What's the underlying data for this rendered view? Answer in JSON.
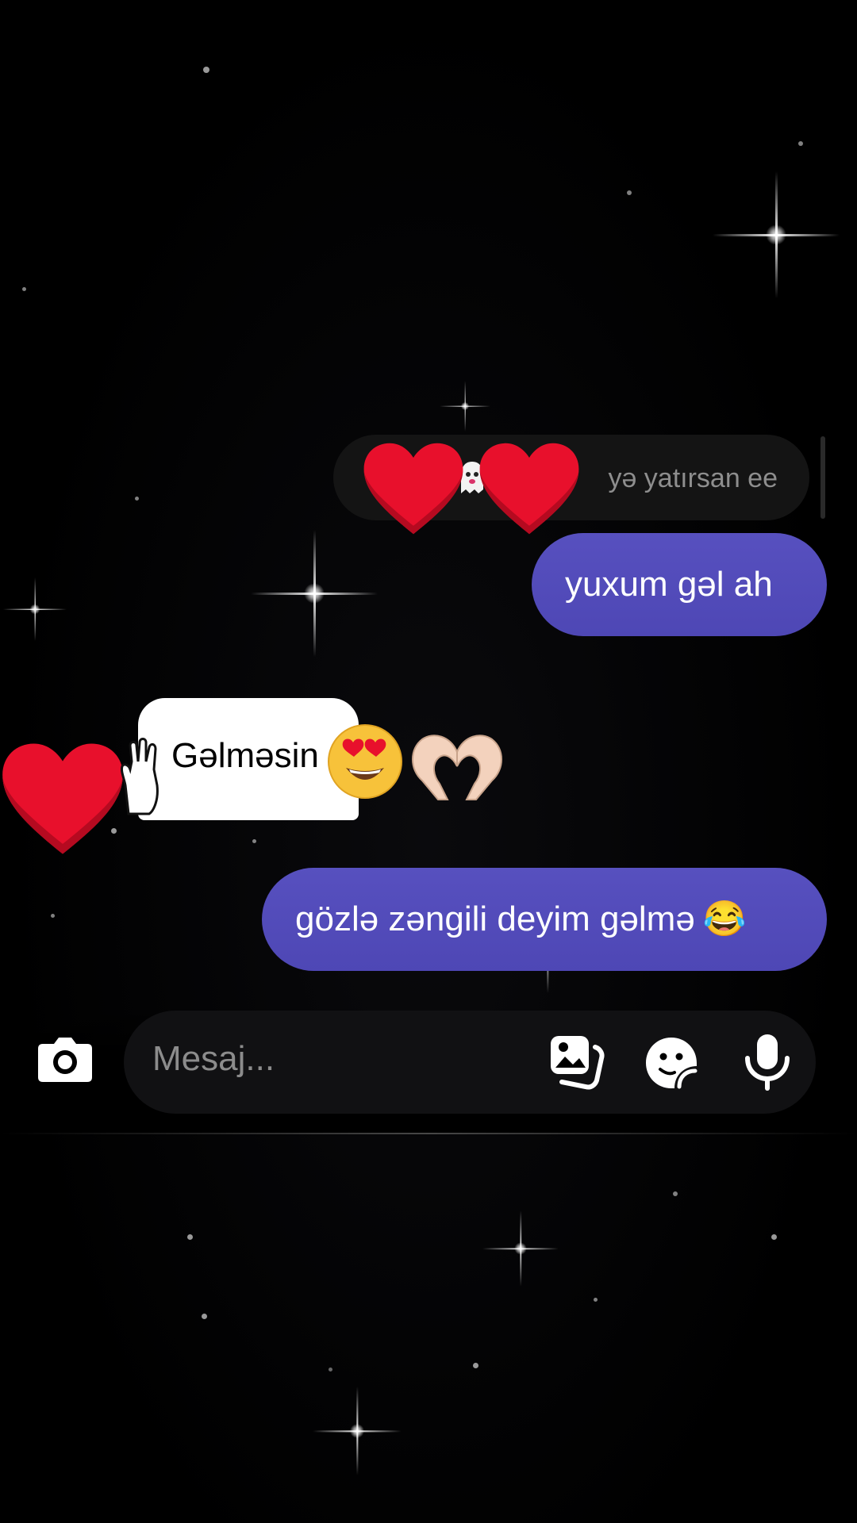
{
  "chat": {
    "reply_preview": {
      "text": "yə yatırsan ee"
    },
    "messages": [
      {
        "direction": "outgoing",
        "text": "yuxum gəl ah"
      },
      {
        "direction": "incoming",
        "text": "Gəlməsin"
      },
      {
        "direction": "outgoing",
        "text": "gözlə zəngili deyim gəlmə",
        "emoji": "😂"
      }
    ]
  },
  "composer": {
    "placeholder": "Mesaj..."
  },
  "colors": {
    "bubble_outgoing": "#5750bf",
    "heart": "#e8102c",
    "background": "#000000"
  },
  "icons": [
    "camera-icon",
    "gallery-icon",
    "sticker-icon",
    "mic-icon",
    "ghost-icon",
    "heart-icon",
    "hand-icon",
    "heart-eyes-emoji",
    "heart-hands-icon"
  ]
}
